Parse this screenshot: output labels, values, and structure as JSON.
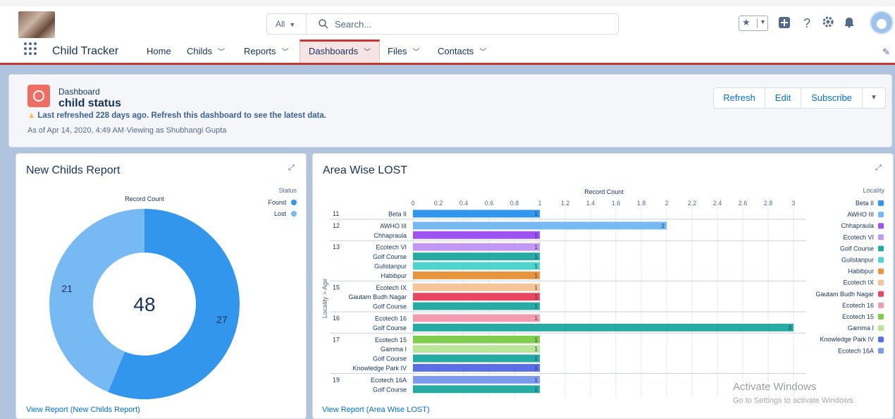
{
  "header": {
    "search_scope": "All",
    "search_placeholder": "Search..."
  },
  "nav": {
    "app_name": "Child Tracker",
    "tabs": [
      {
        "label": "Home",
        "has_menu": false
      },
      {
        "label": "Childs",
        "has_menu": true
      },
      {
        "label": "Reports",
        "has_menu": true
      },
      {
        "label": "Dashboards",
        "has_menu": true,
        "active": true
      },
      {
        "label": "Files",
        "has_menu": true
      },
      {
        "label": "Contacts",
        "has_menu": true
      }
    ]
  },
  "dashboard": {
    "label": "Dashboard",
    "title": "child status",
    "warning": "Last refreshed 228 days ago. Refresh this dashboard to see the latest data.",
    "as_of": "As of Apr 14, 2020, 4:49 AM·Viewing as Shubhangi Gupta",
    "buttons": {
      "refresh": "Refresh",
      "edit": "Edit",
      "subscribe": "Subscribe"
    }
  },
  "new_childs": {
    "title": "New Childs Report",
    "link": "View Report (New Childs Report)"
  },
  "area_lost": {
    "title": "Area Wise LOST",
    "link": "View Report (Area Wise LOST)"
  },
  "watermark": {
    "line1": "Activate Windows",
    "line2": "Go to Settings to activate Windows."
  },
  "chart_data": [
    {
      "type": "pie",
      "variant": "donut",
      "title": "Record Count",
      "center_total": "48",
      "legend_title": "Status",
      "legend_position": "top-right",
      "slices": [
        {
          "label": "Found",
          "value": 27,
          "color": "#3296ed"
        },
        {
          "label": "Lost",
          "value": 21,
          "color": "#77b9f2"
        }
      ]
    },
    {
      "type": "bar",
      "orientation": "horizontal",
      "title": "Record Count",
      "ylabel": "Locality > Age",
      "xlim": [
        0,
        3.1
      ],
      "x_ticks": [
        "0",
        "0.2",
        "0.4",
        "0.6",
        "0.8",
        "1",
        "1.2",
        "1.4",
        "1.6",
        "1.8",
        "2",
        "2.2",
        "2.4",
        "2.6",
        "2.8",
        "3"
      ],
      "grid": true,
      "legend_title": "Locality",
      "legend_position": "right",
      "legend": [
        {
          "name": "Beta II",
          "color": "#3296ed"
        },
        {
          "name": "AWHO III",
          "color": "#77b9f2"
        },
        {
          "name": "Chhapraula",
          "color": "#9d53f2"
        },
        {
          "name": "Ecotech VI",
          "color": "#c398f5"
        },
        {
          "name": "Golf Course",
          "color": "#26aba4"
        },
        {
          "name": "Gulistanpur",
          "color": "#4ed4cd"
        },
        {
          "name": "Habibpur",
          "color": "#e6953d"
        },
        {
          "name": "Ecotech IX",
          "color": "#f5c59a"
        },
        {
          "name": "Gautam Budh Nagar",
          "color": "#e8475f"
        },
        {
          "name": "Ecotech 16",
          "color": "#f29cb0"
        },
        {
          "name": "Ecotech 15",
          "color": "#80cd4e"
        },
        {
          "name": "Gamma I",
          "color": "#bbe59a"
        },
        {
          "name": "Knowledge Park IV",
          "color": "#596ee3"
        },
        {
          "name": "Ecotech 16A",
          "color": "#7d9bec"
        }
      ],
      "groups": [
        {
          "age": "11",
          "rows": [
            {
              "locality": "Beta II",
              "value": 1
            }
          ]
        },
        {
          "age": "12",
          "rows": [
            {
              "locality": "AWHO III",
              "value": 2
            },
            {
              "locality": "Chhapraula",
              "value": 1
            }
          ]
        },
        {
          "age": "13",
          "rows": [
            {
              "locality": "Ecotech VI",
              "value": 1
            },
            {
              "locality": "Golf Course",
              "value": 1
            },
            {
              "locality": "Gulistanpur",
              "value": 1
            },
            {
              "locality": "Habibpur",
              "value": 1
            }
          ]
        },
        {
          "age": "15",
          "rows": [
            {
              "locality": "Ecotech IX",
              "value": 1
            },
            {
              "locality": "Gautam Budh Nagar",
              "value": 1
            },
            {
              "locality": "Golf Course",
              "value": 1
            }
          ]
        },
        {
          "age": "16",
          "rows": [
            {
              "locality": "Ecotech 16",
              "value": 1
            },
            {
              "locality": "Golf Course",
              "value": 3
            }
          ]
        },
        {
          "age": "17",
          "rows": [
            {
              "locality": "Ecotech 15",
              "value": 1
            },
            {
              "locality": "Gamma I",
              "value": 1
            },
            {
              "locality": "Golf Course",
              "value": 1
            },
            {
              "locality": "Knowledge Park IV",
              "value": 1
            }
          ]
        },
        {
          "age": "19",
          "rows": [
            {
              "locality": "Ecotech 16A",
              "value": 1
            },
            {
              "locality": "Golf Course",
              "value": 1
            }
          ]
        }
      ]
    }
  ]
}
